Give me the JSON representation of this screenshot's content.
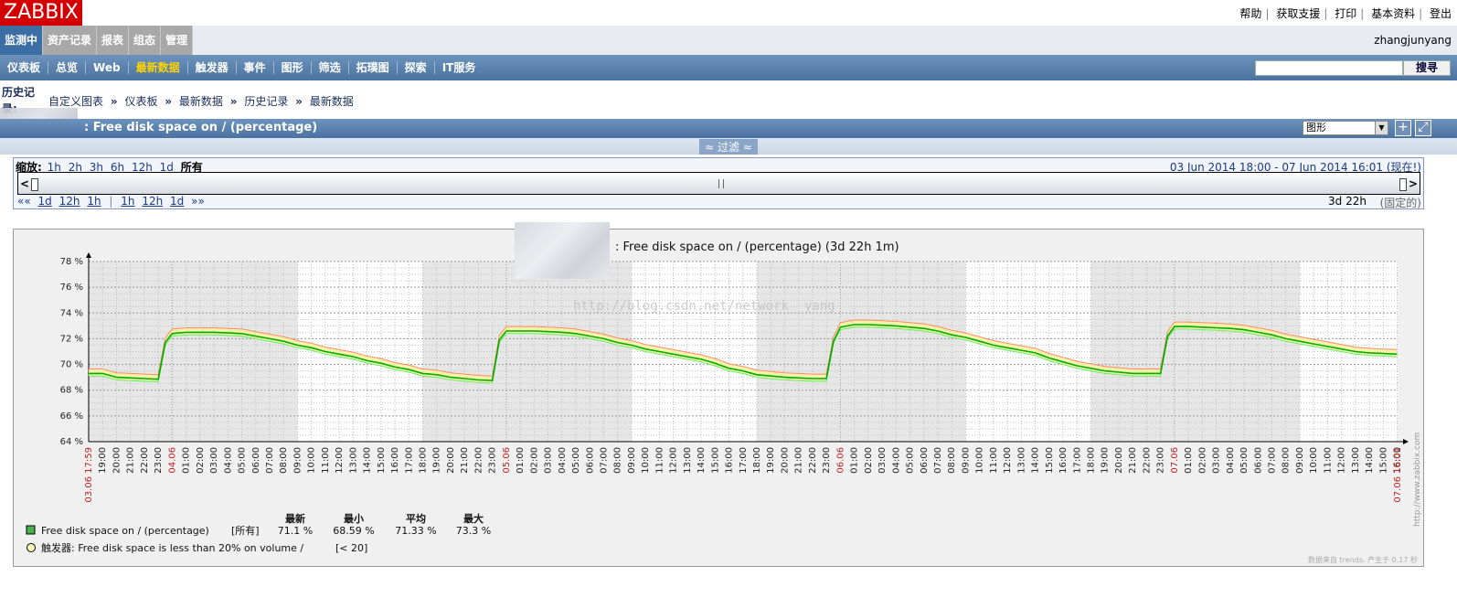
{
  "logo": "ZABBIX",
  "top_links": [
    "帮助",
    "获取支援",
    "打印",
    "基本资料",
    "登出"
  ],
  "main_menu": [
    {
      "label": "监测中",
      "active": true
    },
    {
      "label": "资产记录",
      "active": false
    },
    {
      "label": "报表",
      "active": false
    },
    {
      "label": "组态",
      "active": false
    },
    {
      "label": "管理",
      "active": false
    }
  ],
  "username": "zhangjunyang",
  "sub_menu": [
    {
      "label": "仪表板",
      "active": false
    },
    {
      "label": "总览",
      "active": false
    },
    {
      "label": "Web",
      "active": false
    },
    {
      "label": "最新数据",
      "active": true
    },
    {
      "label": "触发器",
      "active": false
    },
    {
      "label": "事件",
      "active": false
    },
    {
      "label": "图形",
      "active": false
    },
    {
      "label": "筛选",
      "active": false
    },
    {
      "label": "拓璞图",
      "active": false
    },
    {
      "label": "探索",
      "active": false
    },
    {
      "label": "IT服务",
      "active": false
    }
  ],
  "search": {
    "value": "",
    "button_label": "搜寻"
  },
  "history_label": "历史记录:",
  "breadcrumb": [
    "自定义图表",
    "仪表板",
    "最新数据",
    "历史记录",
    "最新数据"
  ],
  "breadcrumb_sep": "»",
  "header": {
    "title": ": Free disk space on / (percentage)",
    "view_select": "图形",
    "add_icon": "plus-icon",
    "fullscreen_icon": "fullscreen-icon"
  },
  "filter": {
    "label": "≈ 过滤 ≈"
  },
  "zoom": {
    "label": "缩放:",
    "options": [
      "1h",
      "2h",
      "3h",
      "6h",
      "12h",
      "1d"
    ],
    "all_label": "所有",
    "period": "03 Jun 2014 18:00  -  07 Jun 2014 16:01 (现在!)",
    "nav_back_arrow": "««",
    "nav_back": [
      "1d",
      "12h",
      "1h"
    ],
    "nav_forward": [
      "1h",
      "12h",
      "1d"
    ],
    "nav_forward_arrow": "»»",
    "period_length": "3d 22h",
    "fixed_label": "(固定的)"
  },
  "graph": {
    "title": ": Free disk space on / (percentage) (3d 22h 1m)",
    "watermark": "http://blog.csdn.net/network__yang",
    "side_credit": "http://www.zabbix.com",
    "footer_note": "数据来自 trends. 产生于 0.17 秒",
    "legend_headers": [
      "最新",
      "最小",
      "平均",
      "最大"
    ],
    "legend_series": {
      "name": "Free disk space on / (percentage)",
      "scope": "[所有]",
      "last": "71.1 %",
      "min": "68.59 %",
      "avg": "71.33 %",
      "max": "73.3 %",
      "color": "#4caf50"
    },
    "legend_trigger": {
      "name": "触发器: Free disk space is less than 20% on volume /",
      "cond": "[< 20]",
      "color": "#ffffbb"
    }
  },
  "chart_data": {
    "type": "line",
    "ylabel": "",
    "xlabel": "",
    "ylim": [
      64,
      78
    ],
    "y_ticks": [
      "64 %",
      "66 %",
      "68 %",
      "70 %",
      "72 %",
      "74 %",
      "76 %",
      "78 %"
    ],
    "start_hour_label": "03.06 17:59",
    "end_label": "07.06 16:01",
    "hour_labels": [
      "19:00",
      "20:00",
      "21:00",
      "22:00",
      "23:00",
      "04.06",
      "01:00",
      "02:00",
      "03:00",
      "04:00",
      "05:00",
      "06:00",
      "07:00",
      "08:00",
      "09:00",
      "10:00",
      "11:00",
      "12:00",
      "13:00",
      "14:00",
      "15:00",
      "16:00",
      "17:00",
      "18:00",
      "19:00",
      "20:00",
      "21:00",
      "22:00",
      "23:00",
      "05.06",
      "01:00",
      "02:00",
      "03:00",
      "04:00",
      "05:00",
      "06:00",
      "07:00",
      "08:00",
      "09:00",
      "10:00",
      "11:00",
      "12:00",
      "13:00",
      "14:00",
      "15:00",
      "16:00",
      "17:00",
      "18:00",
      "19:00",
      "20:00",
      "21:00",
      "22:00",
      "23:00",
      "06.06",
      "01:00",
      "02:00",
      "03:00",
      "04:00",
      "05:00",
      "06:00",
      "07:00",
      "08:00",
      "09:00",
      "10:00",
      "11:00",
      "12:00",
      "13:00",
      "14:00",
      "15:00",
      "16:00",
      "17:00",
      "18:00",
      "19:00",
      "20:00",
      "21:00",
      "22:00",
      "23:00",
      "07.06",
      "01:00",
      "02:00",
      "03:00",
      "04:00",
      "05:00",
      "06:00",
      "07:00",
      "08:00",
      "09:00",
      "10:00",
      "11:00",
      "12:00",
      "13:00",
      "14:00",
      "15:00",
      "16:00"
    ],
    "day_labels": [
      "04.06",
      "05.06",
      "06.06",
      "07.06"
    ],
    "series": [
      {
        "name": "Free disk space on / (percentage)",
        "color": "#00aa00",
        "x_hours": [
          0,
          1,
          2,
          3,
          4,
          5,
          5.5,
          6,
          7,
          8,
          9,
          10,
          11,
          12,
          13,
          14,
          15,
          16,
          17,
          18,
          19,
          20,
          21,
          22,
          23,
          24,
          25,
          26,
          27,
          28,
          29,
          29.5,
          30,
          31,
          32,
          33,
          34,
          35,
          36,
          37,
          38,
          39,
          40,
          41,
          42,
          43,
          44,
          45,
          46,
          47,
          48,
          49,
          50,
          51,
          52,
          53,
          53.5,
          54,
          55,
          56,
          57,
          58,
          59,
          60,
          61,
          62,
          63,
          64,
          65,
          66,
          67,
          68,
          69,
          70,
          71,
          72,
          73,
          74,
          75,
          76,
          77,
          77.5,
          78,
          79,
          80,
          81,
          82,
          83,
          84,
          85,
          86,
          87,
          88,
          89,
          90,
          91,
          92,
          93,
          94
        ],
        "avg": [
          69.3,
          69.3,
          69.0,
          68.95,
          68.9,
          68.85,
          71.7,
          72.4,
          72.5,
          72.5,
          72.5,
          72.45,
          72.4,
          72.2,
          72.0,
          71.8,
          71.5,
          71.3,
          71.0,
          70.8,
          70.6,
          70.3,
          70.1,
          69.8,
          69.6,
          69.3,
          69.2,
          69.0,
          68.9,
          68.8,
          68.75,
          71.9,
          72.6,
          72.6,
          72.6,
          72.55,
          72.5,
          72.4,
          72.2,
          72.0,
          71.7,
          71.5,
          71.2,
          71.0,
          70.8,
          70.6,
          70.4,
          70.1,
          69.7,
          69.5,
          69.2,
          69.1,
          69.0,
          68.95,
          68.9,
          68.9,
          71.8,
          72.9,
          73.1,
          73.1,
          73.05,
          73.0,
          72.9,
          72.8,
          72.6,
          72.3,
          72.1,
          71.8,
          71.5,
          71.3,
          71.1,
          70.9,
          70.5,
          70.2,
          69.9,
          69.7,
          69.5,
          69.4,
          69.3,
          69.3,
          69.3,
          72.2,
          72.95,
          72.95,
          72.9,
          72.85,
          72.8,
          72.7,
          72.5,
          72.3,
          72.0,
          71.8,
          71.6,
          71.4,
          71.2,
          71.0,
          70.9,
          70.85,
          70.8
        ],
        "min_offset": -0.2,
        "max_offset": 0.35
      }
    ]
  }
}
